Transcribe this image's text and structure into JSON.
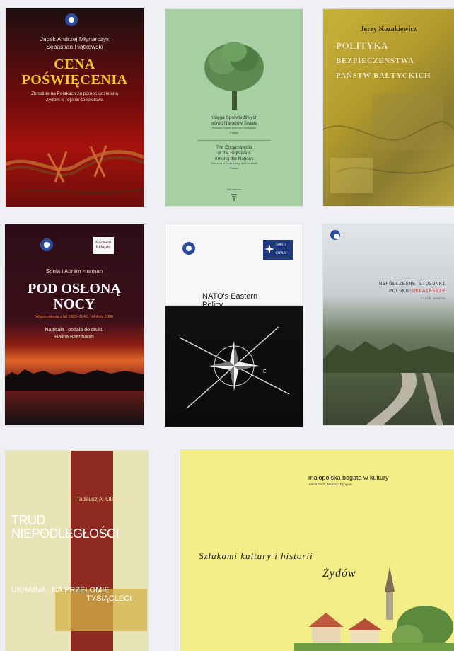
{
  "books": [
    {
      "id": "cena",
      "publisher_logo": "Instytut Studiów Strategicznych",
      "authors": [
        "Jacek Andrzej Młynarczyk",
        "Sebastian Piątkowski"
      ],
      "title": [
        "CENA",
        "POŚWIĘCENIA"
      ],
      "subtitle": [
        "Zbrodnie na Polakach za pomoc udzielaną",
        "Żydom w rejonie Ciepielowa"
      ]
    },
    {
      "id": "ksiega",
      "title_pl": [
        "Księga Sprawiedliwych",
        "wśród Narodów Świata"
      ],
      "sub_pl": "Ratujący Żydów podczas Holokaustu",
      "country_pl": "Polska",
      "title_en": [
        "The Encyclopedia",
        "of the Righteous",
        "Among the Nations"
      ],
      "sub_en": "Rescuers of Jews during the Holocaust",
      "country_en": "Poland",
      "publisher": "Yad Vashem"
    },
    {
      "id": "polityka",
      "author": "Jerzy Kozakiewicz",
      "title": [
        "POLITYKA",
        "BEZPIECZEŃSTWA",
        "PAŃSTW BAŁTYCKICH"
      ]
    },
    {
      "id": "pod-oslona",
      "badge": "Auschwitz Birkenau",
      "authors": "Sonia i Abram Hurman",
      "title": [
        "POD OSŁONĄ",
        "NOCY"
      ],
      "subtitle": "Wspomnienia z lat 1939–1945, Tel-Aviv 2006",
      "note": [
        "Napisała i podała do druku",
        "Halina Birenbaum"
      ]
    },
    {
      "id": "nato",
      "nato_mark": [
        "NATO",
        "OTAN"
      ],
      "title": [
        "NATO's Eastern",
        "Policy"
      ],
      "compass": "E"
    },
    {
      "id": "stosunki",
      "title": [
        "WSPÓŁCZESNE STOSUNKI",
        "POLSKO-",
        "UKRAIŃSKIE"
      ],
      "author": "PIOTR KOSPYK"
    },
    {
      "id": "trud",
      "author": "Tadeusz A. Olszański",
      "title": [
        "TRUD",
        "NIEPODLEGŁOŚCI"
      ],
      "subtitle": [
        "UKRAINA",
        "NA PRZEŁOMIE",
        "TYSIĄCLECI"
      ]
    },
    {
      "id": "malopolska",
      "series": "małopolska bogata w kultury",
      "authors": "Maria Duch, Mateusz Dyngosz",
      "script_line1": "Szlakami kultury i historii",
      "script_line2": "Żydów"
    }
  ],
  "colors": {
    "background": "#eef0f3",
    "cena_title": "#f6c62a",
    "green_cover": "#a7cfa3",
    "yellow_cover": "#f3ee87"
  }
}
